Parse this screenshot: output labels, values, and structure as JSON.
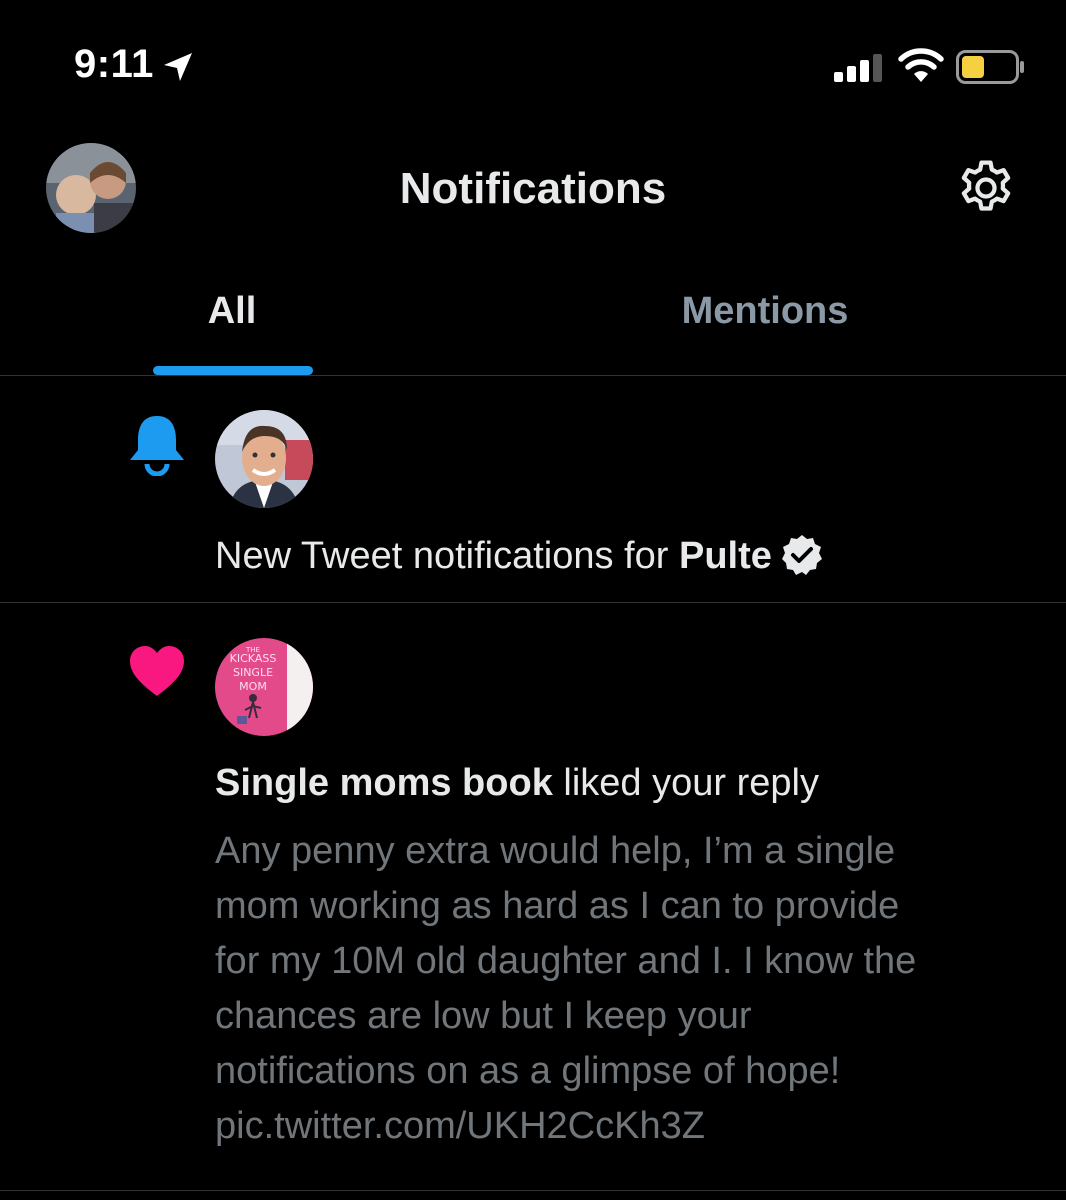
{
  "status_bar": {
    "time": "9:11"
  },
  "header": {
    "title": "Notifications"
  },
  "tabs": [
    {
      "label": "All",
      "active": true
    },
    {
      "label": "Mentions",
      "active": false
    }
  ],
  "notifications": [
    {
      "type": "new_tweet_alert",
      "icon": "bell-icon",
      "icon_color": "#1d9bf0",
      "text_prefix": "New Tweet notifications for ",
      "account_name": "Pulte",
      "verified": true
    },
    {
      "type": "like",
      "icon": "heart-icon",
      "icon_color": "#f91880",
      "actor": "Single moms book",
      "action": " liked your reply",
      "avatar_lines": [
        "THE",
        "KICKASS",
        "SINGLE",
        "MOM"
      ],
      "reply_text": "Any penny extra would help, I’m a single\nmom working as hard as I can to provide\nfor my 10M old daughter and I. I know the\nchances are low but I keep your\nnotifications on as a glimpse of hope!\npic.twitter.com/UKH2CcKh3Z"
    }
  ],
  "colors": {
    "background": "#000000",
    "accent": "#1d9bf0",
    "like": "#f91880",
    "secondary_text": "#71767b"
  }
}
